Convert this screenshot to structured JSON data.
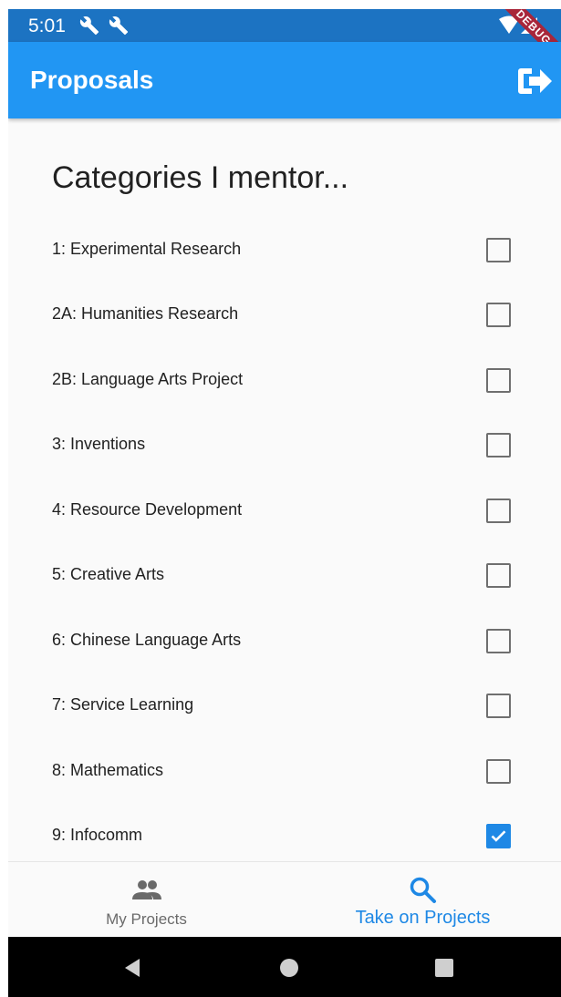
{
  "status_bar": {
    "time": "5:01",
    "debug_label": "DEBUG"
  },
  "app_bar": {
    "title": "Proposals"
  },
  "section": {
    "title": "Categories I mentor..."
  },
  "categories": [
    {
      "label": "1: Experimental Research",
      "checked": false
    },
    {
      "label": "2A: Humanities Research",
      "checked": false
    },
    {
      "label": "2B: Language Arts Project",
      "checked": false
    },
    {
      "label": "3: Inventions",
      "checked": false
    },
    {
      "label": "4: Resource Development",
      "checked": false
    },
    {
      "label": "5: Creative Arts",
      "checked": false
    },
    {
      "label": "6: Chinese Language Arts",
      "checked": false
    },
    {
      "label": "7: Service Learning",
      "checked": false
    },
    {
      "label": "8: Mathematics",
      "checked": false
    },
    {
      "label": "9: Infocomm",
      "checked": true
    }
  ],
  "bottom_nav": {
    "items": [
      {
        "label": "My Projects",
        "icon": "people-icon",
        "active": false
      },
      {
        "label": "Take on Projects",
        "icon": "search-icon",
        "active": true
      }
    ]
  },
  "colors": {
    "primary": "#2196f3",
    "status_bar": "#1c73c2",
    "accent": "#1e88e5"
  }
}
